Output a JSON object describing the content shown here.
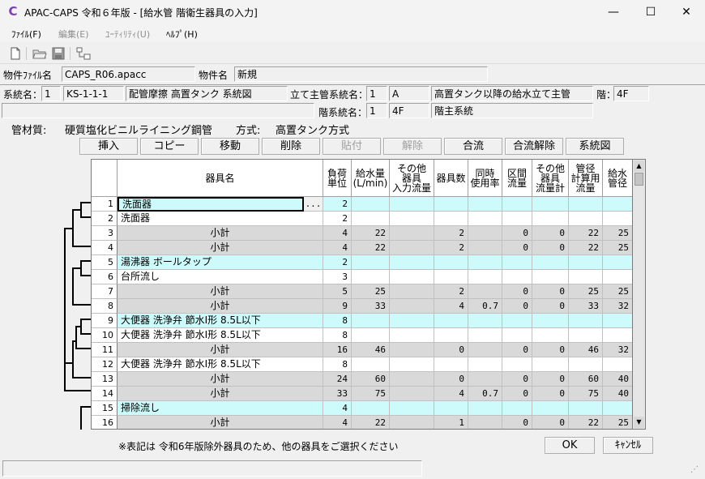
{
  "window": {
    "title": "APAC-CAPS 令和６年版 - [給水管 階衛生器具の入力]",
    "minimize": "—",
    "maximize": "☐",
    "close": "✕"
  },
  "menu": [
    {
      "label": "ﾌｧｲﾙ(F)",
      "enabled": true
    },
    {
      "label": "編集(E)",
      "enabled": false
    },
    {
      "label": "ﾕｰﾃｨﾘﾃｨ(U)",
      "enabled": false
    },
    {
      "label": "ﾍﾙﾌﾟ(H)",
      "enabled": true
    }
  ],
  "toolbar_icons": [
    "new-file-icon",
    "open-folder-icon",
    "save-disk-icon",
    "network-icon"
  ],
  "file": {
    "label": "物件ﾌｧｲﾙ名",
    "value": "CAPS_R06.apacc",
    "name_label": "物件名",
    "name_value": "新規"
  },
  "system": {
    "label": "系統名：",
    "no": "1",
    "code": "KS-1-1-1",
    "desc": "配管摩擦 高置タンク 系統図",
    "riser_label": "立て主管系統名：",
    "riser_no": "1",
    "riser_code": "A",
    "riser_desc": "高置タンク以降の給水立て主管",
    "floor_label": "階：",
    "floor_value": "4F",
    "floor_sys_label": "階系統名：",
    "floor_sys_no": "1",
    "floor_sys_code": "4F",
    "floor_sys_desc": "階主系統"
  },
  "material": {
    "label": "管材質:",
    "value": "硬質塩化ビニルライニング鋼管",
    "method_label": "方式:",
    "method_value": "高置タンク方式"
  },
  "buttons": [
    {
      "label": "挿入",
      "enabled": true
    },
    {
      "label": "コピー",
      "enabled": true
    },
    {
      "label": "移動",
      "enabled": true
    },
    {
      "label": "削除",
      "enabled": true
    },
    {
      "label": "貼付",
      "enabled": false
    },
    {
      "label": "解除",
      "enabled": false
    },
    {
      "label": "合流",
      "enabled": true
    },
    {
      "label": "合流解除",
      "enabled": true
    },
    {
      "label": "系統図",
      "enabled": true
    }
  ],
  "grid": {
    "headers": [
      "器具名",
      "負荷\n単位",
      "給水量\n(L/min)",
      "その他\n器具\n入力流量",
      "器具数",
      "同時\n使用率",
      "区間\n流量",
      "その他\n器具\n流量計",
      "管径\n計算用\n流量",
      "給水\n管径"
    ],
    "ellipsis": "...",
    "rows": [
      {
        "no": "1",
        "type": "item",
        "name": "洗面器",
        "load": "2",
        "flow": "",
        "other": "",
        "count": "",
        "rate": "",
        "sect": "",
        "otherSum": "",
        "calc": "",
        "dia": ""
      },
      {
        "no": "2",
        "type": "item2",
        "name": "洗面器",
        "load": "2",
        "flow": "",
        "other": "",
        "count": "",
        "rate": "",
        "sect": "",
        "otherSum": "",
        "calc": "",
        "dia": ""
      },
      {
        "no": "3",
        "type": "sub",
        "name": "小計",
        "load": "4",
        "flow": "22",
        "other": "",
        "count": "2",
        "rate": "",
        "sect": "0",
        "otherSum": "0",
        "calc": "22",
        "dia": "25"
      },
      {
        "no": "4",
        "type": "sub",
        "name": "小計",
        "load": "4",
        "flow": "22",
        "other": "",
        "count": "2",
        "rate": "",
        "sect": "0",
        "otherSum": "0",
        "calc": "22",
        "dia": "25"
      },
      {
        "no": "5",
        "type": "item",
        "name": "湯沸器 ボールタップ",
        "load": "2",
        "flow": "",
        "other": "",
        "count": "",
        "rate": "",
        "sect": "",
        "otherSum": "",
        "calc": "",
        "dia": ""
      },
      {
        "no": "6",
        "type": "item2",
        "name": "台所流し",
        "load": "3",
        "flow": "",
        "other": "",
        "count": "",
        "rate": "",
        "sect": "",
        "otherSum": "",
        "calc": "",
        "dia": ""
      },
      {
        "no": "7",
        "type": "sub",
        "name": "小計",
        "load": "5",
        "flow": "25",
        "other": "",
        "count": "2",
        "rate": "",
        "sect": "0",
        "otherSum": "0",
        "calc": "25",
        "dia": "25"
      },
      {
        "no": "8",
        "type": "sub",
        "name": "小計",
        "load": "9",
        "flow": "33",
        "other": "",
        "count": "4",
        "rate": "0.7",
        "sect": "0",
        "otherSum": "0",
        "calc": "33",
        "dia": "32"
      },
      {
        "no": "9",
        "type": "item",
        "name": "大便器 洗浄弁 節水Ⅰ形 8.5L以下",
        "load": "8",
        "flow": "",
        "other": "",
        "count": "",
        "rate": "",
        "sect": "",
        "otherSum": "",
        "calc": "",
        "dia": ""
      },
      {
        "no": "10",
        "type": "item2",
        "name": "大便器 洗浄弁 節水Ⅰ形 8.5L以下",
        "load": "8",
        "flow": "",
        "other": "",
        "count": "",
        "rate": "",
        "sect": "",
        "otherSum": "",
        "calc": "",
        "dia": ""
      },
      {
        "no": "11",
        "type": "sub",
        "name": "小計",
        "load": "16",
        "flow": "46",
        "other": "",
        "count": "0",
        "rate": "",
        "sect": "0",
        "otherSum": "0",
        "calc": "46",
        "dia": "32"
      },
      {
        "no": "12",
        "type": "item2",
        "name": "大便器 洗浄弁 節水Ⅰ形 8.5L以下",
        "load": "8",
        "flow": "",
        "other": "",
        "count": "",
        "rate": "",
        "sect": "",
        "otherSum": "",
        "calc": "",
        "dia": ""
      },
      {
        "no": "13",
        "type": "sub",
        "name": "小計",
        "load": "24",
        "flow": "60",
        "other": "",
        "count": "0",
        "rate": "",
        "sect": "0",
        "otherSum": "0",
        "calc": "60",
        "dia": "40"
      },
      {
        "no": "14",
        "type": "sub",
        "name": "小計",
        "load": "33",
        "flow": "75",
        "other": "",
        "count": "4",
        "rate": "0.7",
        "sect": "0",
        "otherSum": "0",
        "calc": "75",
        "dia": "40"
      },
      {
        "no": "15",
        "type": "item",
        "name": "掃除流し",
        "load": "4",
        "flow": "",
        "other": "",
        "count": "",
        "rate": "",
        "sect": "",
        "otherSum": "",
        "calc": "",
        "dia": ""
      },
      {
        "no": "16",
        "type": "sub",
        "name": "小計",
        "load": "4",
        "flow": "22",
        "other": "",
        "count": "1",
        "rate": "",
        "sect": "0",
        "otherSum": "0",
        "calc": "22",
        "dia": "25"
      }
    ]
  },
  "footer": {
    "note": "※表記は 令和6年版除外器具のため、他の器具をご選択ください",
    "ok": "OK",
    "cancel": "ｷｬﾝｾﾙ"
  },
  "colors": {
    "item_row": "#cdfafa",
    "subtotal_row": "#d9d9d9",
    "selected_border": "#000000"
  }
}
